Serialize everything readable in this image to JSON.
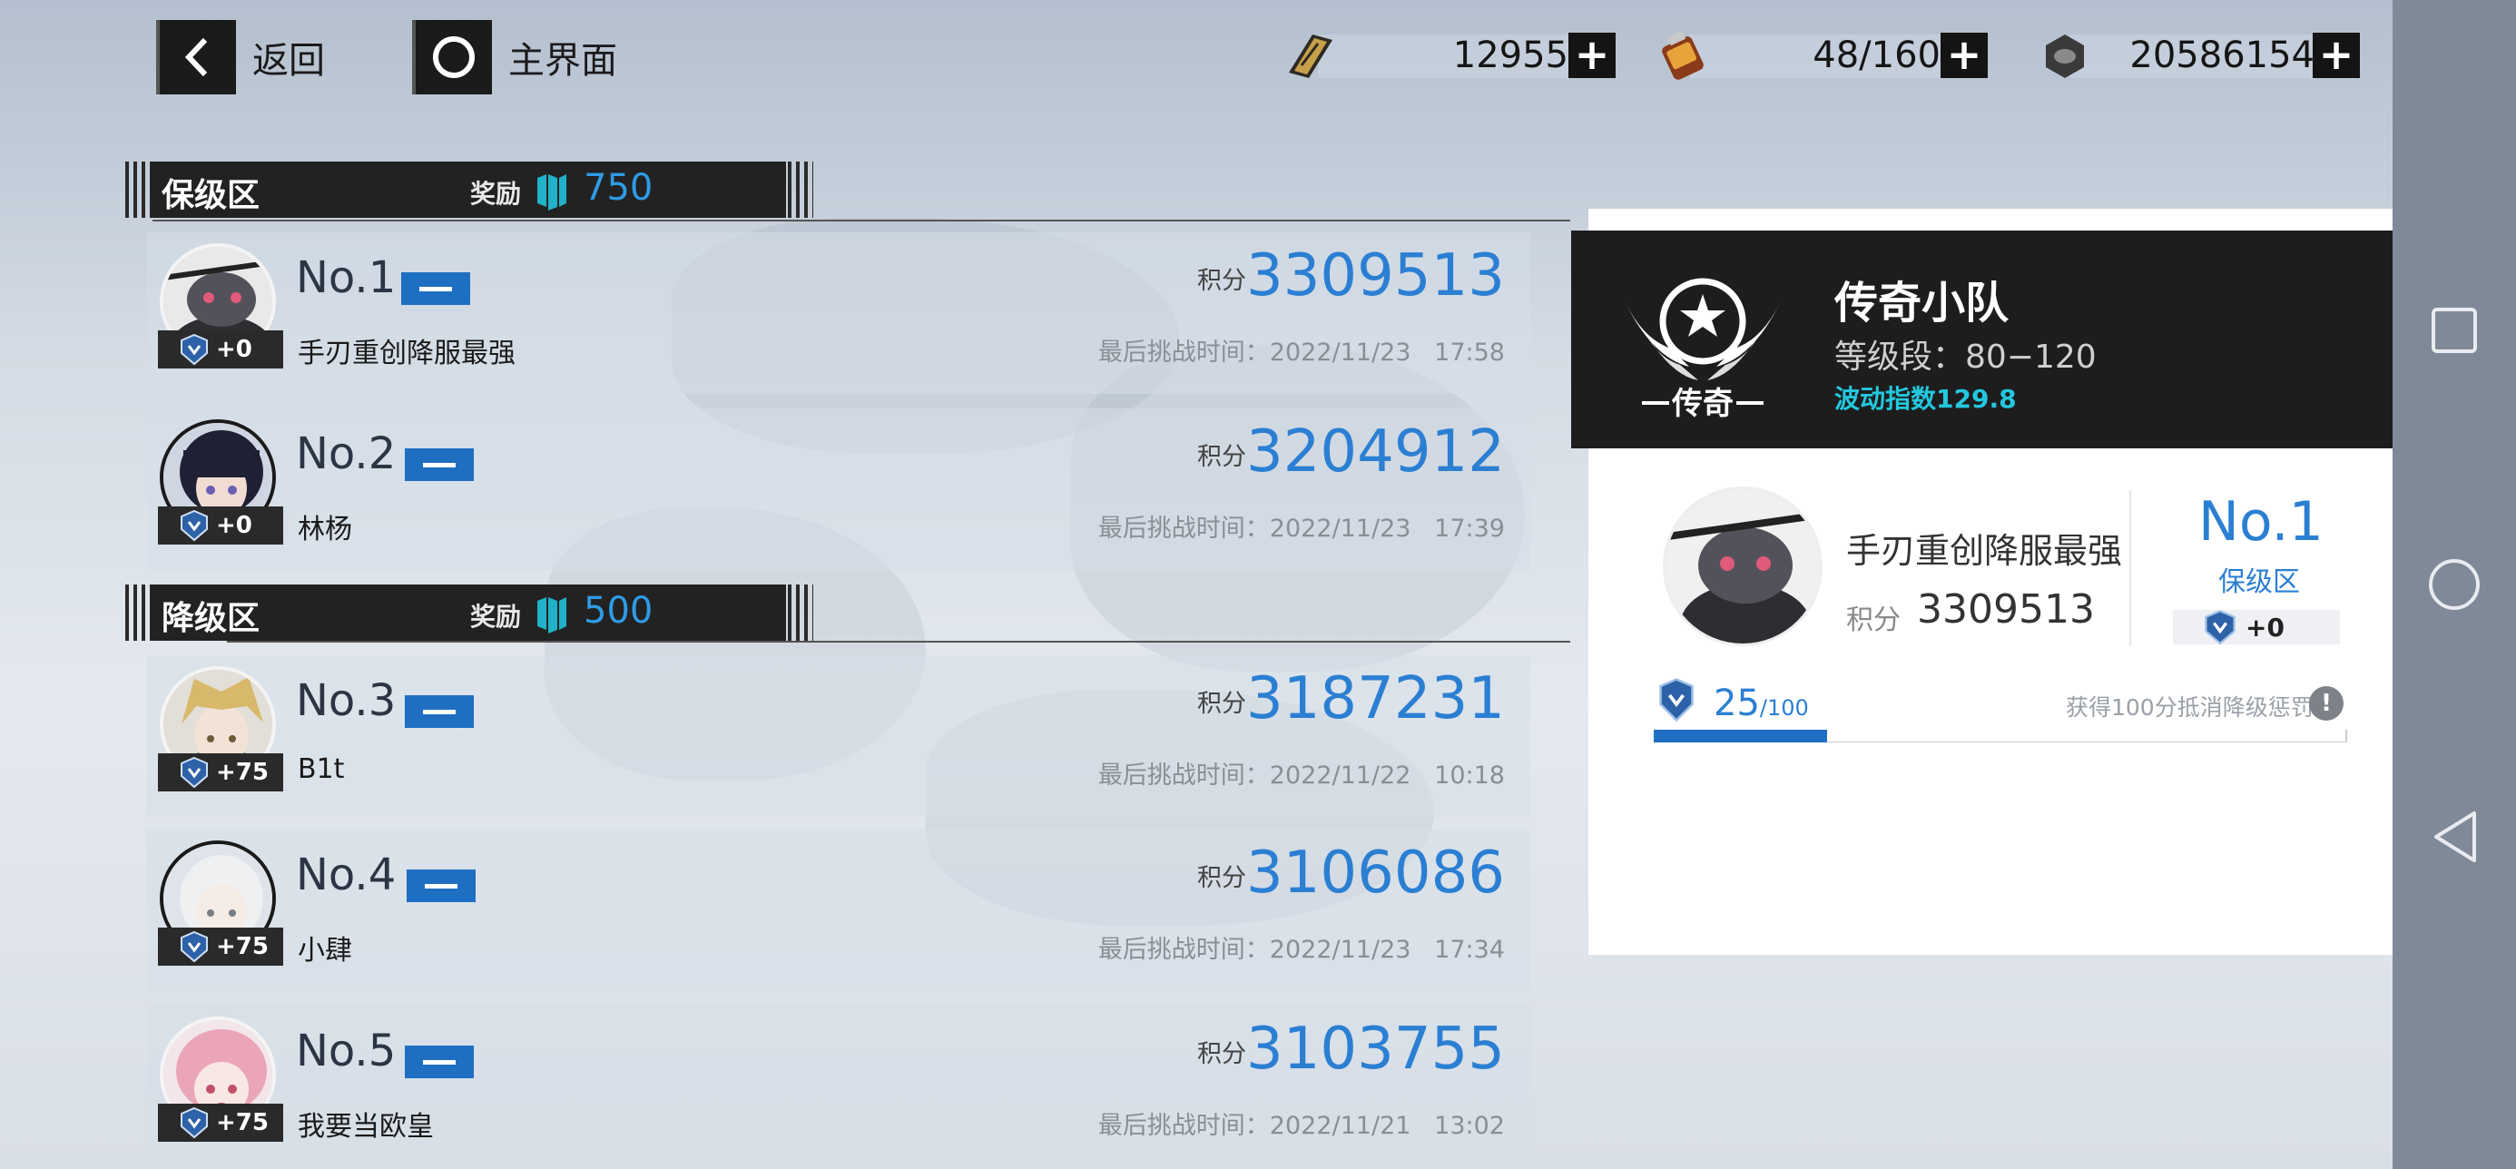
{
  "nav": {
    "back_label": "返回",
    "home_label": "主界面"
  },
  "resources": [
    {
      "icon": "ticket-icon",
      "value": "12955"
    },
    {
      "icon": "battery-icon",
      "value": "48/160"
    },
    {
      "icon": "gear-nut-icon",
      "value": "20586154"
    }
  ],
  "zones": {
    "safe": {
      "name": "保级区",
      "reward_label": "奖励",
      "reward_value": "750"
    },
    "demote": {
      "name": "降级区",
      "reward_label": "奖励",
      "reward_value": "500"
    }
  },
  "score_label": "积分",
  "ranking": [
    {
      "rank": "No.1",
      "name": "手刃重创降服最强",
      "score": "3309513",
      "badge": "+0",
      "last": "最后挑战时间：2022/11/23   17:58"
    },
    {
      "rank": "No.2",
      "name": "林杨",
      "score": "3204912",
      "badge": "+0",
      "last": "最后挑战时间：2022/11/23   17:39"
    },
    {
      "rank": "No.3",
      "name": "B1t",
      "score": "3187231",
      "badge": "+75",
      "last": "最后挑战时间：2022/11/22   10:18"
    },
    {
      "rank": "No.4",
      "name": "小肆",
      "score": "3106086",
      "badge": "+75",
      "last": "最后挑战时间：2022/11/23   17:34"
    },
    {
      "rank": "No.5",
      "name": "我要当欧皇",
      "score": "3103755",
      "badge": "+75",
      "last": "最后挑战时间：2022/11/21   13:02"
    }
  ],
  "team": {
    "emblem_text": "传奇",
    "name": "传奇小队",
    "level_range": "等级段：80−120",
    "wave_index": "波动指数129.8"
  },
  "me": {
    "name": "手刃重创降服最强",
    "score_label": "积分",
    "score": "3309513",
    "rank": "No.1",
    "zone": "保级区",
    "badge": "+0",
    "progress_value": "25",
    "progress_max": "/100",
    "progress_fraction": 0.25,
    "hint": "获得100分抵消降级惩罚",
    "hint_icon": "!"
  },
  "colors": {
    "accent": "#2b7fd3",
    "cyan": "#23c8de",
    "dark": "#1d1d1d"
  }
}
